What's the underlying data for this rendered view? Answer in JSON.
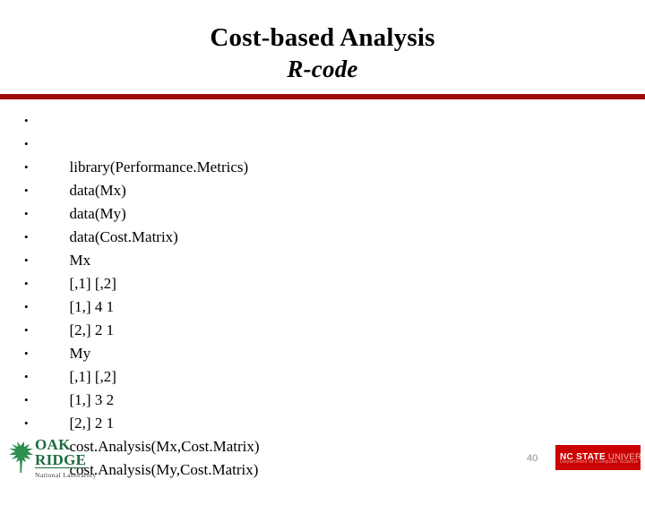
{
  "slide": {
    "title_main": "Cost-based Analysis",
    "title_sub": "R-code",
    "divider_color": "#9e0a0a",
    "page_number": "40"
  },
  "code_lines": [
    {
      "text": "library(Performance.Metrics)"
    },
    {
      "text": "data(Mx)"
    },
    {
      "text": "data(My)"
    },
    {
      "text": "data(Cost.Matrix)"
    },
    {
      "text": "Mx"
    },
    {
      "text": "[,1] [,2]"
    },
    {
      "text": "[1,] 4 1"
    },
    {
      "text": "[2,] 2 1"
    },
    {
      "text": "My"
    },
    {
      "text": "[,1] [,2]"
    },
    {
      "text": "[1,] 3 2"
    },
    {
      "text": "[2,] 2 1"
    },
    {
      "text": "cost.Analysis(Mx,Cost.Matrix)"
    },
    {
      "text": "cost.Analysis(My,Cost.Matrix)"
    }
  ],
  "bullet_glyph": "•",
  "logos": {
    "ornl": {
      "line1": "OAK",
      "line2": "RIDGE",
      "line3": "National Laboratory",
      "leaf_color": "#2f8f4e",
      "text_color": "#1d6b3f"
    },
    "ncsu": {
      "line1_bold": "NC STATE",
      "line1_light": "UNIVERSITY",
      "line2": "Department of Computer Science",
      "background_color": "#cc0000"
    }
  }
}
